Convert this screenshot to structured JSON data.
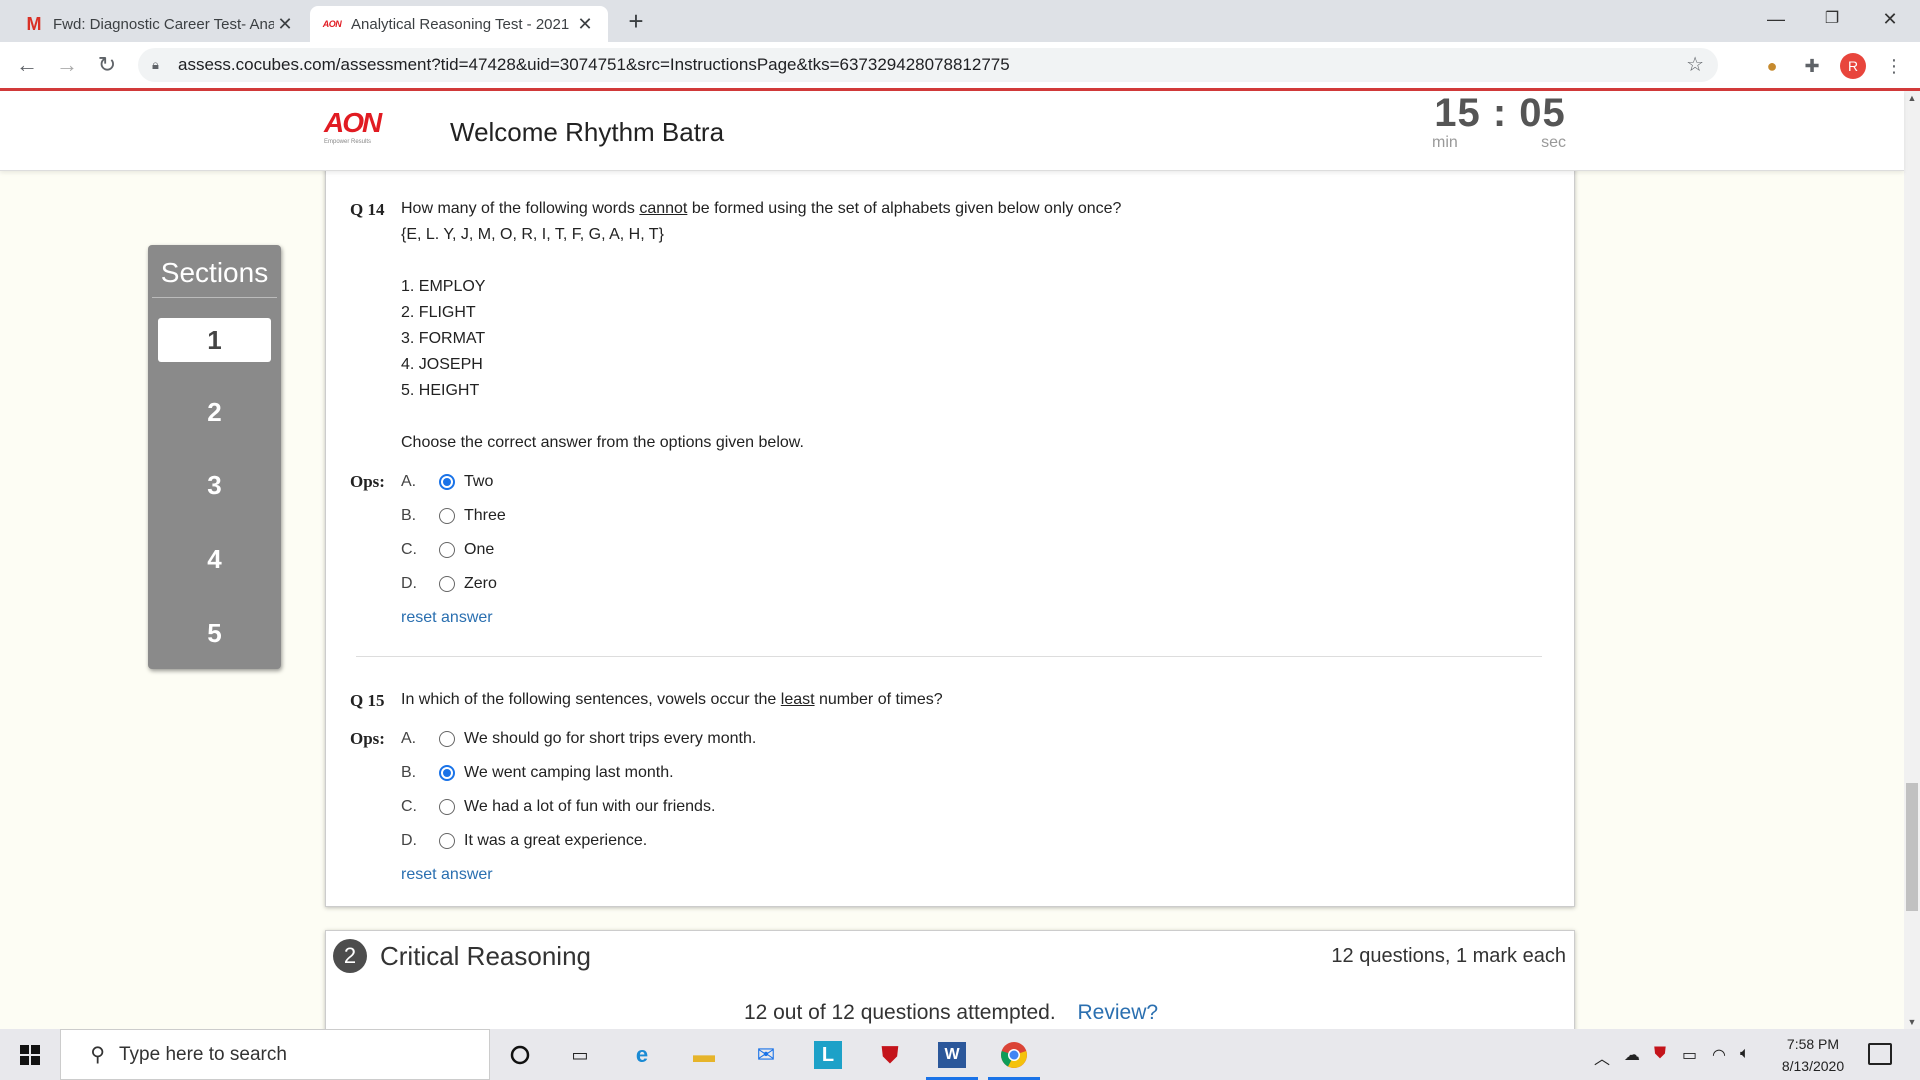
{
  "browser": {
    "tabs": [
      {
        "title": "Fwd: Diagnostic Career Test- Ana",
        "icon": "gmail-icon",
        "favicon": "M"
      },
      {
        "title": "Analytical Reasoning Test - 2021",
        "icon": "aon-icon",
        "favicon": "AON"
      }
    ],
    "new_tab": "+",
    "url": "assess.cocubes.com/assessment?tid=47428&uid=3074751&src=InstructionsPage&tks=637329428078812775",
    "profile_initial": "R"
  },
  "header": {
    "logo_text": "AON",
    "logo_tagline": "Empower Results",
    "welcome": "Welcome Rhythm Batra",
    "timer": {
      "minutes": "15",
      "separator": ":",
      "seconds": "05",
      "min_label": "min",
      "sec_label": "sec"
    }
  },
  "sidebar": {
    "title": "Sections",
    "items": [
      "1",
      "2",
      "3",
      "4",
      "5"
    ],
    "active_index": 0
  },
  "questions": [
    {
      "number": "Q 14",
      "text_before": "How many of the following words ",
      "text_underlined": "cannot",
      "text_after": " be formed using the set of alphabets given below only once?",
      "set": "{E, L. Y, J, M, O, R, I, T, F, G, A, H, T}",
      "list": [
        "1. EMPLOY",
        "2. FLIGHT",
        "3. FORMAT",
        "4. JOSEPH",
        "5. HEIGHT"
      ],
      "instruction": "Choose the correct answer from the options given below.",
      "ops_label": "Ops:",
      "options": [
        {
          "letter": "A.",
          "text": "Two",
          "selected": true
        },
        {
          "letter": "B.",
          "text": "Three",
          "selected": false
        },
        {
          "letter": "C.",
          "text": "One",
          "selected": false
        },
        {
          "letter": "D.",
          "text": "Zero",
          "selected": false
        }
      ],
      "reset": "reset answer"
    },
    {
      "number": "Q 15",
      "text_before": "In which of the following sentences, vowels occur the ",
      "text_underlined": "least",
      "text_after": " number of times?",
      "ops_label": "Ops:",
      "options": [
        {
          "letter": "A.",
          "text": "We should go for short trips every month.",
          "selected": false
        },
        {
          "letter": "B.",
          "text": "We went camping last month.",
          "selected": true
        },
        {
          "letter": "C.",
          "text": "We had a lot of fun with our friends.",
          "selected": false
        },
        {
          "letter": "D.",
          "text": "It was a great experience.",
          "selected": false
        }
      ],
      "reset": "reset answer"
    }
  ],
  "next_section": {
    "number": "2",
    "title": "Critical Reasoning",
    "meta": "12 questions, 1 mark each",
    "attempted": "12 out of 12 questions attempted.",
    "review": "Review?"
  },
  "taskbar": {
    "search_placeholder": "Type here to search",
    "time": "7:58 PM",
    "date": "8/13/2020"
  },
  "colors": {
    "accent": "#1a73e8",
    "brand_red": "#e11b22",
    "sidebar_bg": "#8a8a8a",
    "page_bg": "#fdfdf4",
    "link": "#2a6fb0"
  }
}
